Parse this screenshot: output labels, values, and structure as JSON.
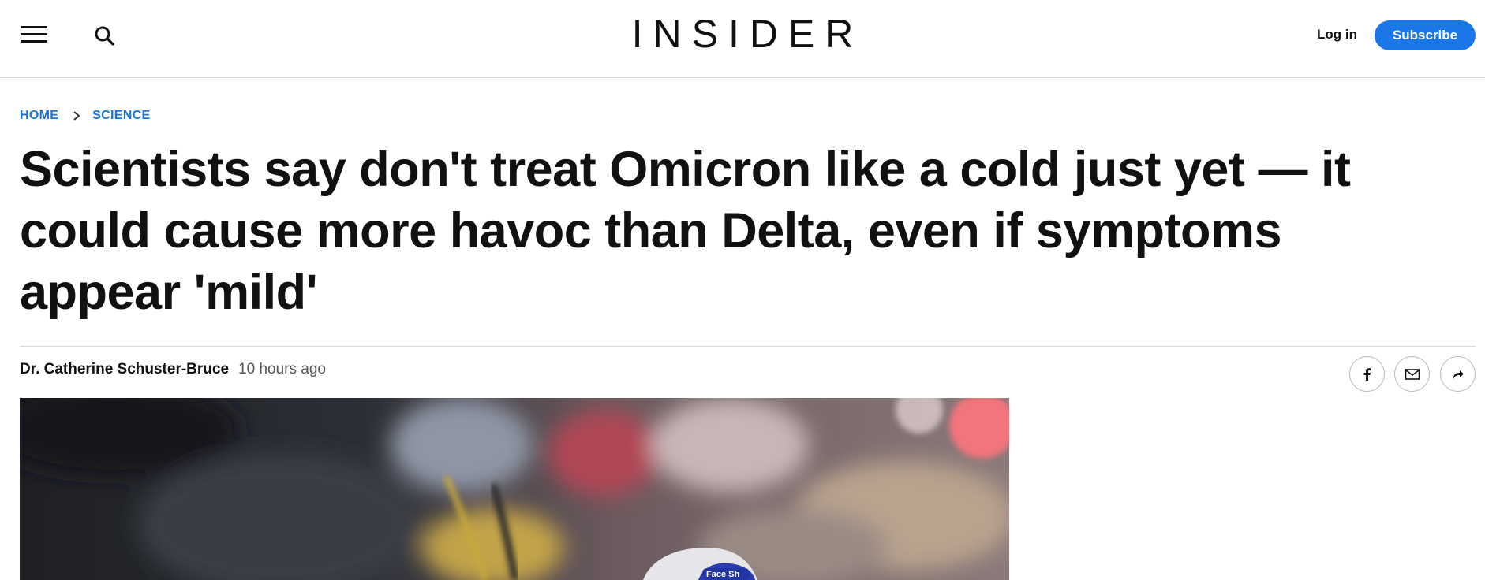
{
  "header": {
    "logo": "INSIDER",
    "login_label": "Log in",
    "subscribe_label": "Subscribe",
    "icons": [
      "menu-icon",
      "search-icon"
    ]
  },
  "breadcrumb": {
    "items": [
      "HOME",
      "SCIENCE"
    ]
  },
  "article": {
    "headline": "Scientists say don't treat Omicron like a cold just yet — it could cause more havoc than Delta, even if symptoms appear 'mild'",
    "author": "Dr. Catherine Schuster-Bruce",
    "timestamp": "10 hours ago",
    "hero_image_text": "Face Sh"
  },
  "share": {
    "icons": [
      "facebook-icon",
      "email-icon",
      "share-forward-icon"
    ]
  },
  "colors": {
    "accent": "#1977e8",
    "link": "#1a73d9",
    "text": "#111111",
    "muted": "#555555",
    "divider": "#d9d9d9"
  }
}
